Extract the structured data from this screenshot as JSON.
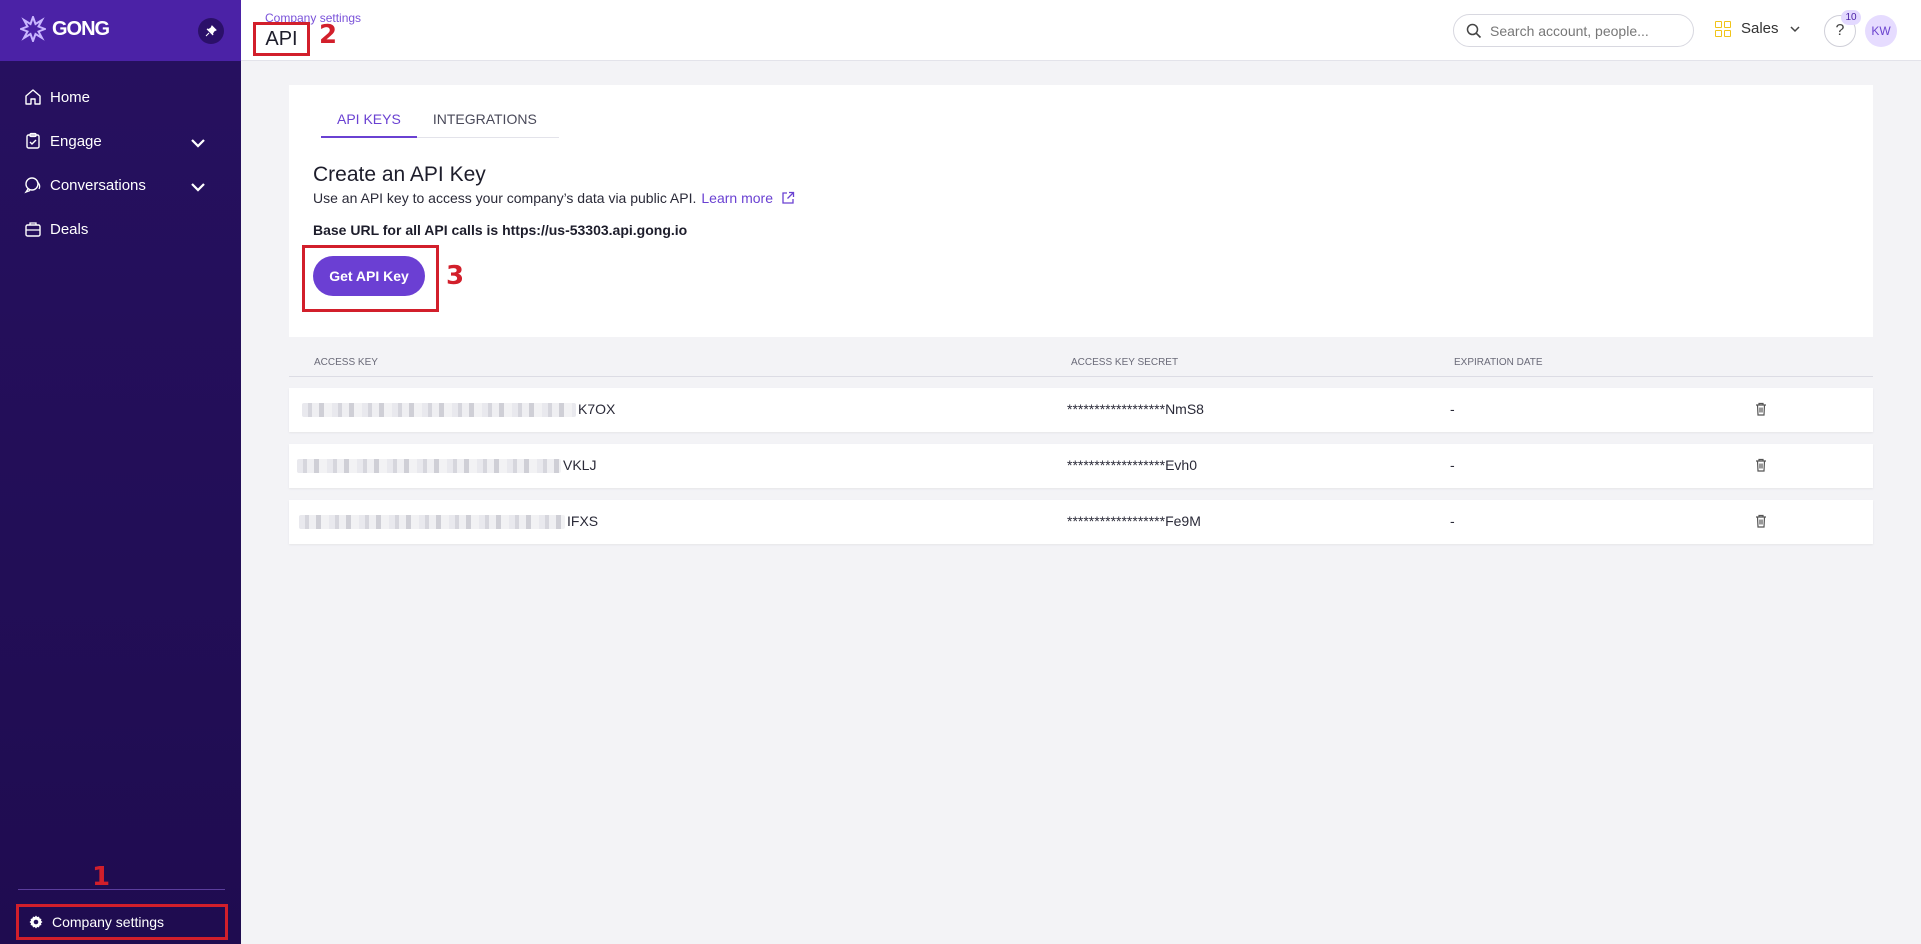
{
  "sidebar": {
    "logo_text": "GONG",
    "nav": [
      {
        "label": "Home",
        "icon": "home-icon"
      },
      {
        "label": "Engage",
        "icon": "clipboard-icon",
        "expandable": true
      },
      {
        "label": "Conversations",
        "icon": "chat-icon",
        "expandable": true
      },
      {
        "label": "Deals",
        "icon": "briefcase-icon"
      }
    ],
    "company_settings_label": "Company settings"
  },
  "header": {
    "breadcrumb": "Company settings",
    "title": "API",
    "search_placeholder": "Search account, people...",
    "workspace": "Sales",
    "help_label": "?",
    "help_badge": "10",
    "avatar_initials": "KW"
  },
  "annotations": {
    "step1": "1",
    "step2": "2",
    "step3": "3",
    "color": "#d21f2b"
  },
  "tabs": [
    {
      "label": "API KEYS",
      "active": true
    },
    {
      "label": "INTEGRATIONS",
      "active": false
    }
  ],
  "create_section": {
    "title": "Create an API Key",
    "description": "Use an API key to access your company’s data via public API.",
    "learn_more": "Learn more",
    "base_url_text": "Base URL for all API calls is https://us-53303.api.gong.io",
    "button_label": "Get API Key"
  },
  "table": {
    "columns": [
      "ACCESS KEY",
      "ACCESS KEY SECRET",
      "EXPIRATION DATE"
    ],
    "rows": [
      {
        "access_key_suffix": "K7OX",
        "secret": "******************NmS8",
        "expiration": "-"
      },
      {
        "access_key_suffix": "VKLJ",
        "secret": "******************Evh0",
        "expiration": "-"
      },
      {
        "access_key_suffix": "IFXS",
        "secret": "******************Fe9M",
        "expiration": "-"
      }
    ]
  },
  "colors": {
    "accent": "#6b3fd3",
    "sidebar": "#26105f"
  }
}
